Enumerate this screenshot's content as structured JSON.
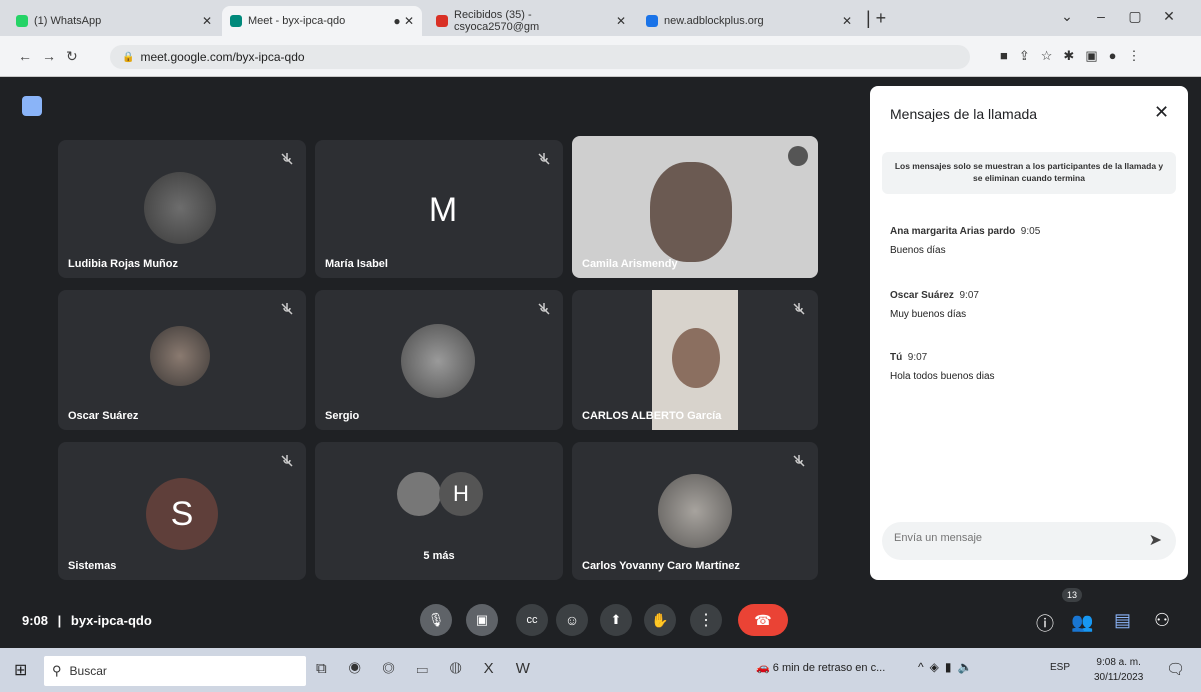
{
  "browser": {
    "tabs": [
      {
        "title": "(1) WhatsApp",
        "favicon_color": "#25d366"
      },
      {
        "title": "Meet - byx-ipca-qdo",
        "favicon_color": "#00897b"
      },
      {
        "title": "Recibidos (35) - csyoca2570@gm",
        "favicon_color": "#d93025"
      },
      {
        "title": "new.adblockplus.org",
        "favicon_color": "#1a73e8"
      }
    ],
    "url": "meet.google.com/byx-ipca-qdo"
  },
  "meet": {
    "participants": [
      {
        "name": "Ludibia Rojas Muñoz",
        "type": "photo"
      },
      {
        "name": "María Isabel",
        "type": "letter",
        "letter": "M"
      },
      {
        "name": "Camila Arismendy",
        "type": "video"
      },
      {
        "name": "Oscar Suárez",
        "type": "photo"
      },
      {
        "name": "Sergio",
        "type": "photo"
      },
      {
        "name": "CARLOS ALBERTO García",
        "type": "video"
      },
      {
        "name": "Sistemas",
        "type": "letter",
        "letter": "S"
      },
      {
        "name": "5 más",
        "type": "group",
        "letter": "H"
      },
      {
        "name": "Carlos Yovanny Caro Martínez",
        "type": "photo"
      }
    ],
    "meeting_time": "9:08",
    "separator": "|",
    "meeting_code": "byx-ipca-qdo",
    "people_count": "13"
  },
  "chat": {
    "title": "Mensajes de la llamada",
    "notice": "Los mensajes solo se muestran a los participantes de la llamada y se eliminan cuando termina",
    "messages": [
      {
        "sender": "Ana margarita Arias pardo",
        "time": "9:05",
        "text": "Buenos días"
      },
      {
        "sender": "Oscar Suárez",
        "time": "9:07",
        "text": "Muy buenos días"
      },
      {
        "sender": "Tú",
        "time": "9:07",
        "text": "Hola todos buenos dias"
      }
    ],
    "input_placeholder": "Envía un mensaje"
  },
  "taskbar": {
    "search_label": "Buscar",
    "notification": "6 min de retraso en c...",
    "lang": "ESP",
    "time": "9:08 a. m.",
    "date": "30/11/2023"
  },
  "colors": {
    "meet_bg": "#1f2124",
    "tile_bg": "#2d2f33",
    "end_call_red": "#ea4335",
    "send_blue": "#1a73e8"
  }
}
